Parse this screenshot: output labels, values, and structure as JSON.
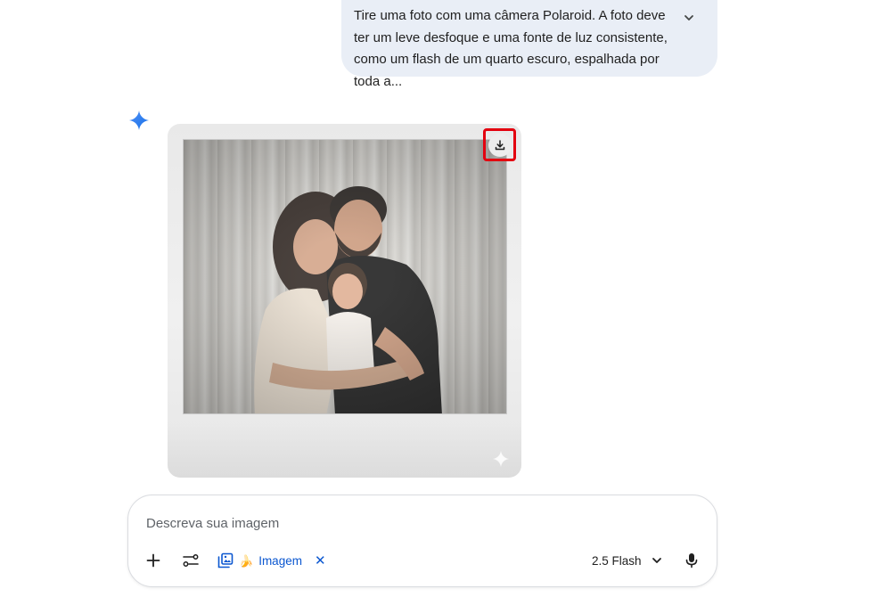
{
  "prompt": {
    "text": "Tire uma foto com uma câmera Polaroid. A foto deve ter um leve desfoque e uma fonte de luz consistente, como um flash de um quarto escuro, espalhada por toda a..."
  },
  "response": {
    "avatar_icon": "gemini-sparkle-icon",
    "image": {
      "download_icon": "download-icon",
      "highlight_color": "#e3000f"
    }
  },
  "composer": {
    "placeholder": "Descreva sua imagem",
    "chip": {
      "emoji": "🍌",
      "label": "Imagem"
    },
    "model": "2.5 Flash"
  },
  "colors": {
    "accent": "#0b57d0",
    "bubble": "#e9eef6"
  }
}
